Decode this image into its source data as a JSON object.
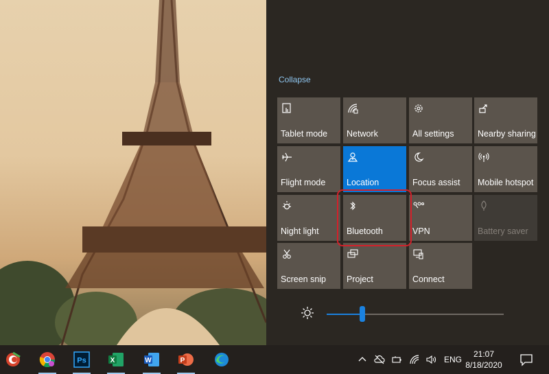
{
  "action_center": {
    "collapse_label": "Collapse",
    "tiles": [
      {
        "label": "Tablet mode",
        "icon": "tablet-mode-icon",
        "state": "off"
      },
      {
        "label": "Network",
        "icon": "network-icon",
        "state": "off"
      },
      {
        "label": "All settings",
        "icon": "gear-icon",
        "state": "off"
      },
      {
        "label": "Nearby sharing",
        "icon": "nearby-sharing-icon",
        "state": "off"
      },
      {
        "label": "Flight mode",
        "icon": "airplane-icon",
        "state": "off"
      },
      {
        "label": "Location",
        "icon": "location-icon",
        "state": "on"
      },
      {
        "label": "Focus assist",
        "icon": "moon-icon",
        "state": "off"
      },
      {
        "label": "Mobile hotspot",
        "icon": "hotspot-icon",
        "state": "off"
      },
      {
        "label": "Night light",
        "icon": "night-light-icon",
        "state": "off"
      },
      {
        "label": "Bluetooth",
        "icon": "bluetooth-icon",
        "state": "off"
      },
      {
        "label": "VPN",
        "icon": "vpn-icon",
        "state": "off"
      },
      {
        "label": "Battery saver",
        "icon": "battery-saver-icon",
        "state": "disabled"
      },
      {
        "label": "Screen snip",
        "icon": "screen-snip-icon",
        "state": "off"
      },
      {
        "label": "Project",
        "icon": "project-icon",
        "state": "off"
      },
      {
        "label": "Connect",
        "icon": "connect-icon",
        "state": "off"
      }
    ],
    "brightness": {
      "level": 0.2,
      "icon": "brightness-icon"
    },
    "accent_color": "#0a78d7",
    "highlight_color": "#d4202a"
  },
  "taskbar": {
    "apps": [
      {
        "name": "CCleaner",
        "icon": "ccleaner-icon"
      },
      {
        "name": "Chrome",
        "icon": "chrome-icon"
      },
      {
        "name": "Photoshop",
        "icon": "photoshop-icon",
        "glyph": "Ps"
      },
      {
        "name": "Excel",
        "icon": "excel-icon",
        "glyph": "X"
      },
      {
        "name": "Word",
        "icon": "word-icon",
        "glyph": "W"
      },
      {
        "name": "PowerPoint",
        "icon": "powerpoint-icon",
        "glyph": "P"
      },
      {
        "name": "Edge",
        "icon": "edge-icon"
      }
    ],
    "tray": {
      "language": "ENG",
      "time": "21:07",
      "date": "8/18/2020"
    }
  }
}
